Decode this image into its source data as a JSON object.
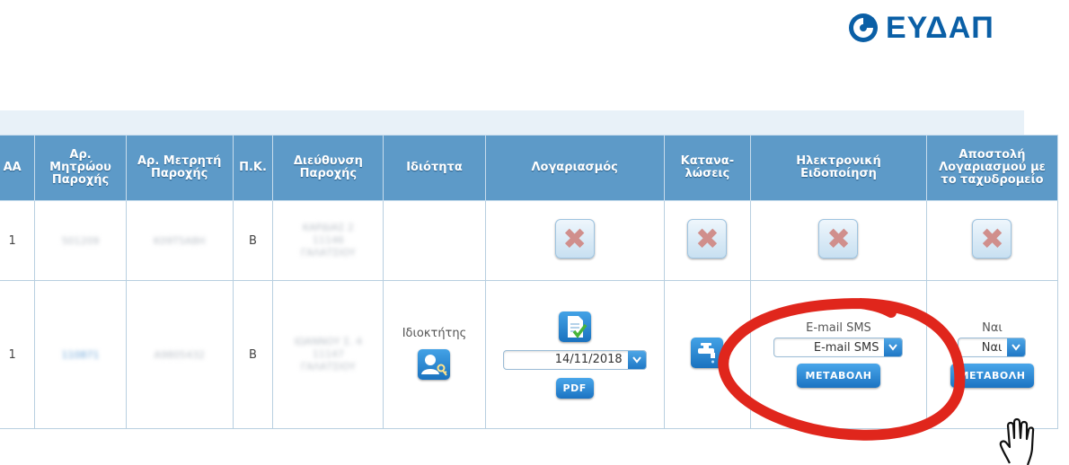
{
  "brand": {
    "name": "ΕΥΔΑΠ",
    "color": "#0a5fa6"
  },
  "table": {
    "headers": {
      "aa": "ΑΑ",
      "registry": [
        "Αρ.",
        "Μητρώου",
        "Παροχής"
      ],
      "meter": [
        "Αρ. Μετρητή",
        "Παροχής"
      ],
      "pk": "Π.Κ.",
      "address": [
        "Διεύθυνση",
        "Παροχής"
      ],
      "role": "Ιδιότητα",
      "bill": "Λογαριασμός",
      "consumption": [
        "Καταναλώσεις"
      ],
      "e_notify": [
        "Ηλεκτρονική",
        "Ειδοποίηση"
      ],
      "post": [
        "Αποστολή",
        "Λογαριασμού με",
        "το ταχυδρομείο"
      ]
    },
    "rows": [
      {
        "aa": "1",
        "registry": "501209",
        "meter": "K09T5A8H",
        "pk": "Β",
        "address": [
          "ΚΑΡΔΙΑΣ 2",
          "11146",
          "ΓΑΛΑΤΣΙΟΥ"
        ]
      },
      {
        "aa": "1",
        "registry": "110871",
        "meter": "A9805432",
        "pk": "Β",
        "address": [
          "ΙΩΑΝΝΟΥ Σ. 4",
          "11147",
          "ΓΑΛΑΤΣΙΟΥ"
        ],
        "role": "Ιδιοκτήτης",
        "bill_date": "14/11/2018",
        "pdf_label": "PDF",
        "notify_current": "E-mail SMS",
        "notify_selected": "E-mail SMS",
        "post_current": "Ναι",
        "post_selected": "Ναι",
        "change_label": "ΜΕΤΑΒΟΛΗ"
      }
    ]
  },
  "icons": {
    "disabled": "x-disabled-icon",
    "owner": "user-key-icon",
    "document": "document-check-icon",
    "consumption": "faucet-icon",
    "dropdown": "chevron-down-icon",
    "cursor": "hand-pointer-icon"
  },
  "annotation": {
    "color": "#e0261c"
  }
}
